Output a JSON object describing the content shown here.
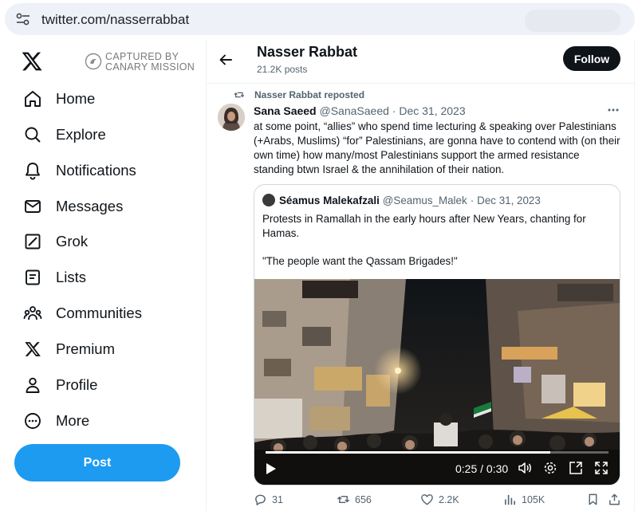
{
  "browser": {
    "url": "twitter.com/nasserrabbat"
  },
  "sidebar": {
    "logo": "x-logo-icon",
    "watermark": {
      "line1": "CAPTURED BY",
      "line2": "CANARY MISSION"
    },
    "items": [
      {
        "label": "Home",
        "icon": "home-icon"
      },
      {
        "label": "Explore",
        "icon": "search-icon"
      },
      {
        "label": "Notifications",
        "icon": "bell-icon"
      },
      {
        "label": "Messages",
        "icon": "envelope-icon"
      },
      {
        "label": "Grok",
        "icon": "grok-icon"
      },
      {
        "label": "Lists",
        "icon": "list-icon"
      },
      {
        "label": "Communities",
        "icon": "people-icon"
      },
      {
        "label": "Premium",
        "icon": "x-logo-icon"
      },
      {
        "label": "Profile",
        "icon": "person-icon"
      },
      {
        "label": "More",
        "icon": "more-circle-icon"
      }
    ],
    "post_label": "Post"
  },
  "header": {
    "name": "Nasser Rabbat",
    "post_count": "21.2K posts",
    "follow_label": "Follow"
  },
  "tweet": {
    "repost_label": "Nasser Rabbat reposted",
    "author_name": "Sana Saeed",
    "author_handle": "@SanaSaeed",
    "separator": "·",
    "date": "Dec 31, 2023",
    "text": "at some point, “allies” who spend time lecturing & speaking over Palestinians (+Arabs, Muslims) “for” Palestinians, are gonna have to contend with (on their own time) how many/most Palestinians support the armed resistance standing btwn Israel & the annihilation of their nation.",
    "quote": {
      "author_name": "Séamus Malekafzali",
      "author_handle": "@Seamus_Malek",
      "separator": "·",
      "date": "Dec 31, 2023",
      "text1": "Protests in Ramallah in the early hours after New Years, chanting for Hamas.",
      "text2": "\"The people want the Qassam Brigades!\"",
      "video": {
        "current_time": "0:25",
        "duration": "0:30",
        "time_display": "0:25 / 0:30",
        "progress": 0.83
      }
    },
    "actions": {
      "replies": "31",
      "reposts": "656",
      "likes": "2.2K",
      "views": "105K"
    }
  },
  "colors": {
    "accent": "#1d9bf0",
    "text": "#0f1419",
    "muted": "#536471",
    "follow_bg": "#0f1419"
  }
}
